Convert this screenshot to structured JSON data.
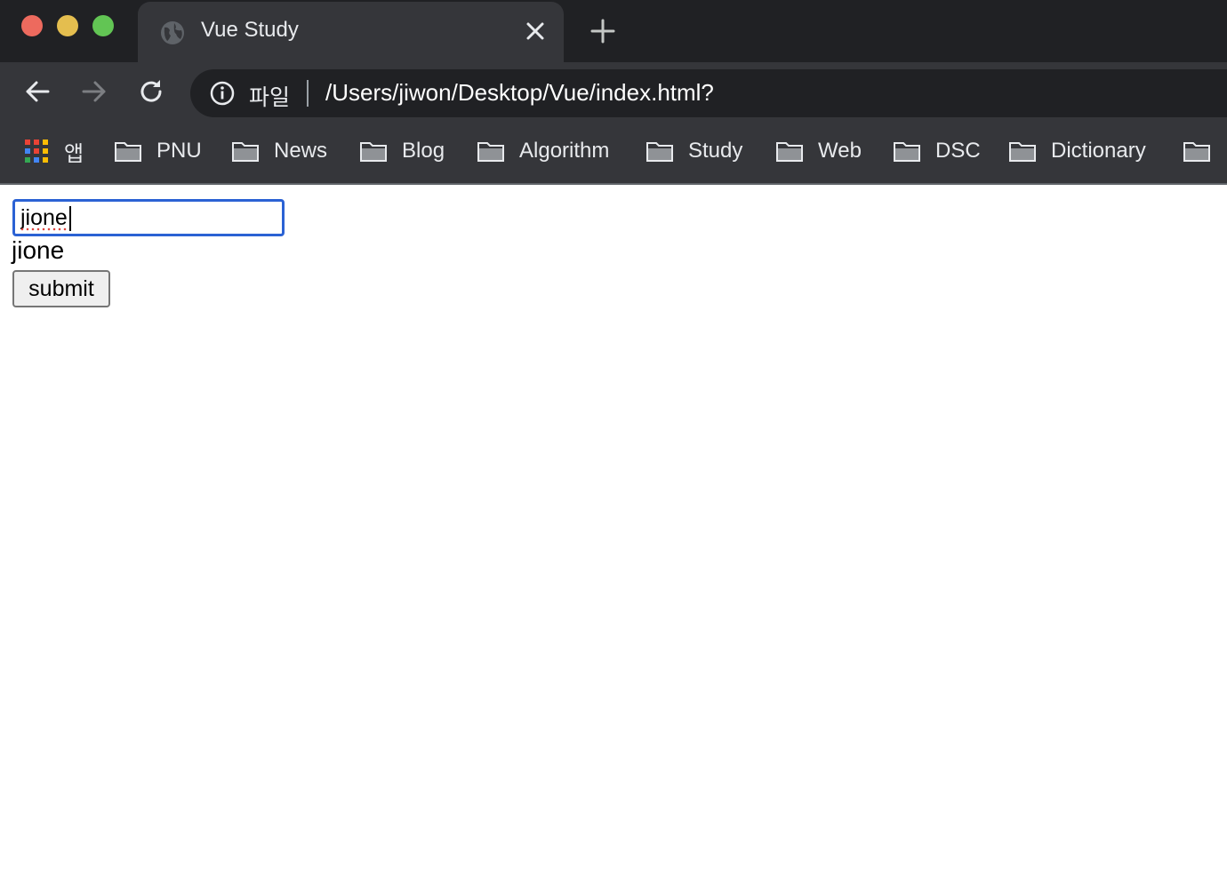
{
  "window": {
    "traffic_lights": {
      "close": "#ed6a5e",
      "minimize": "#e4be4f",
      "zoom": "#62c554"
    }
  },
  "tab": {
    "title": "Vue Study",
    "icon": "globe-icon"
  },
  "toolbar": {
    "scheme_label": "파일",
    "url": "/Users/jiwon/Desktop/Vue/index.html?"
  },
  "bookmarks": {
    "apps_label": "앱",
    "items": [
      {
        "label": "PNU"
      },
      {
        "label": "News"
      },
      {
        "label": "Blog"
      },
      {
        "label": "Algorithm"
      },
      {
        "label": "Study"
      },
      {
        "label": "Web"
      },
      {
        "label": "DSC"
      },
      {
        "label": "Dictionary"
      }
    ]
  },
  "page": {
    "input_value": "jione",
    "echo_text": "jione",
    "submit_label": "submit"
  },
  "colors": {
    "focus_ring": "#2b62d4",
    "chrome_dark": "#202124",
    "chrome_toolbar": "#35363a"
  }
}
